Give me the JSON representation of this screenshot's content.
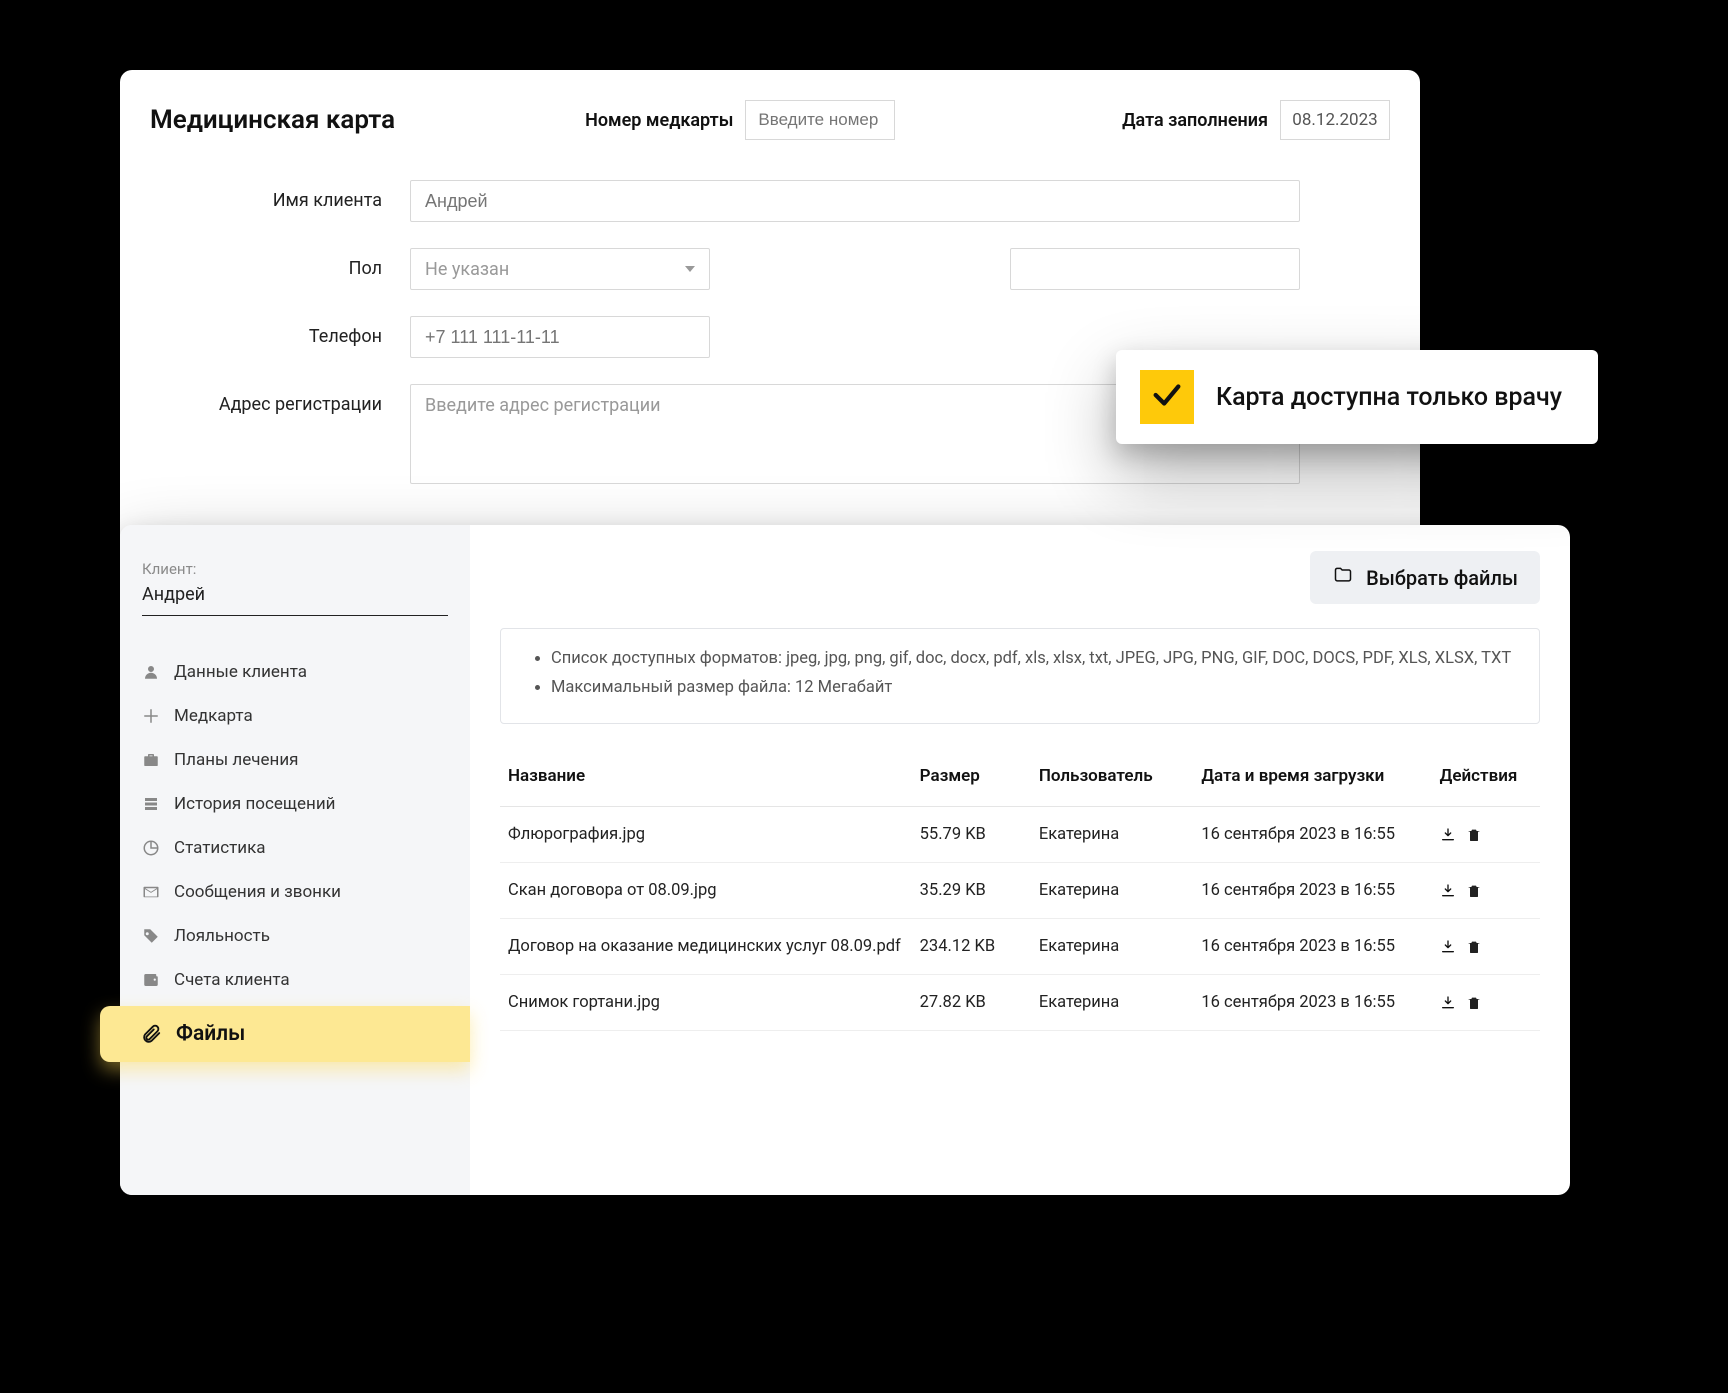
{
  "card": {
    "title": "Медицинская карта",
    "number_label": "Номер медкарты",
    "number_placeholder": "Введите номер",
    "date_label": "Дата заполнения",
    "date_value": "08.12.2023",
    "fields": {
      "name_label": "Имя клиента",
      "name_placeholder": "Андрей",
      "gender_label": "Пол",
      "gender_value": "Не указан",
      "phone_label": "Телефон",
      "phone_placeholder": "+7 111 111-11-11",
      "address_label": "Адрес регистрации",
      "address_placeholder": "Введите адрес регистрации"
    }
  },
  "doctor_banner": {
    "text": "Карта доступна только врачу"
  },
  "sidebar": {
    "client_label": "Клиент:",
    "client_name": "Андрей",
    "items": [
      {
        "label": "Данные клиента",
        "icon": "user"
      },
      {
        "label": "Медкарта",
        "icon": "plus"
      },
      {
        "label": "Планы лечения",
        "icon": "briefcase"
      },
      {
        "label": "История посещений",
        "icon": "history"
      },
      {
        "label": "Статистика",
        "icon": "pie"
      },
      {
        "label": "Сообщения и звонки",
        "icon": "mail"
      },
      {
        "label": "Лояльность",
        "icon": "tag"
      },
      {
        "label": "Счета клиента",
        "icon": "wallet"
      }
    ],
    "active": {
      "label": "Файлы",
      "icon": "clip"
    }
  },
  "files_panel": {
    "choose_label": "Выбрать файлы",
    "info": {
      "formats": "Список доступных форматов: jpeg, jpg, png, gif, doc, docx, pdf, xls, xlsx, txt, JPEG, JPG, PNG, GIF, DOC, DOCS, PDF, XLS, XLSX, TXT",
      "maxsize": "Максимальный размер файла: 12 Мегабайт"
    },
    "columns": {
      "name": "Название",
      "size": "Размер",
      "user": "Пользователь",
      "time": "Дата и время загрузки",
      "actions": "Действия"
    },
    "rows": [
      {
        "name": "Флюрография.jpg",
        "size": "55.79 KB",
        "user": "Екатерина",
        "time": "16 сентября 2023 в 16:55"
      },
      {
        "name": "Скан договора от 08.09.jpg",
        "size": "35.29 KB",
        "user": "Екатерина",
        "time": "16 сентября 2023 в 16:55"
      },
      {
        "name": "Договор на оказание медицинских услуг 08.09.pdf",
        "size": "234.12 KB",
        "user": "Екатерина",
        "time": "16 сентября 2023 в 16:55"
      },
      {
        "name": "Снимок гортани.jpg",
        "size": "27.82 KB",
        "user": "Екатерина",
        "time": "16 сентября 2023 в 16:55"
      }
    ]
  }
}
